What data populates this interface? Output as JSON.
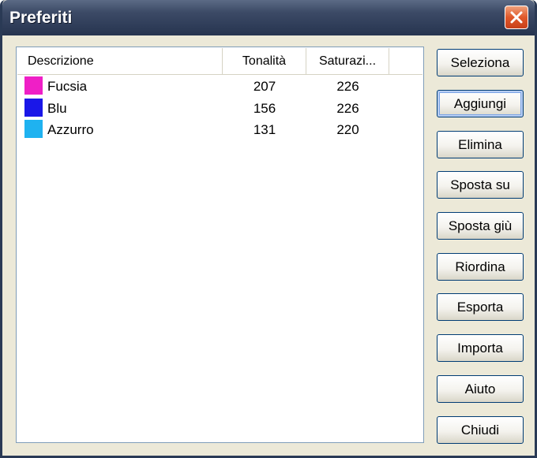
{
  "window": {
    "title": "Preferiti"
  },
  "list": {
    "columns": {
      "descrizione": "Descrizione",
      "tonalita": "Tonalità",
      "saturazione": "Saturazi..."
    },
    "rows": [
      {
        "name": "Fucsia",
        "tonalita": "207",
        "saturazione": "226",
        "color": "#ef1fc6"
      },
      {
        "name": "Blu",
        "tonalita": "156",
        "saturazione": "226",
        "color": "#1a17e8"
      },
      {
        "name": "Azzurro",
        "tonalita": "131",
        "saturazione": "220",
        "color": "#1fb2f0"
      }
    ]
  },
  "buttons": {
    "seleziona": "Seleziona",
    "aggiungi": "Aggiungi",
    "elimina": "Elimina",
    "sposta_su": "Sposta su",
    "sposta_giu": "Sposta giù",
    "riordina": "Riordina",
    "esporta": "Esporta",
    "importa": "Importa",
    "aiuto": "Aiuto",
    "chiudi": "Chiudi"
  },
  "colors": {
    "titlebar": "#26344f",
    "dialog_face": "#ece9d8",
    "close_button": "#e0582a"
  }
}
